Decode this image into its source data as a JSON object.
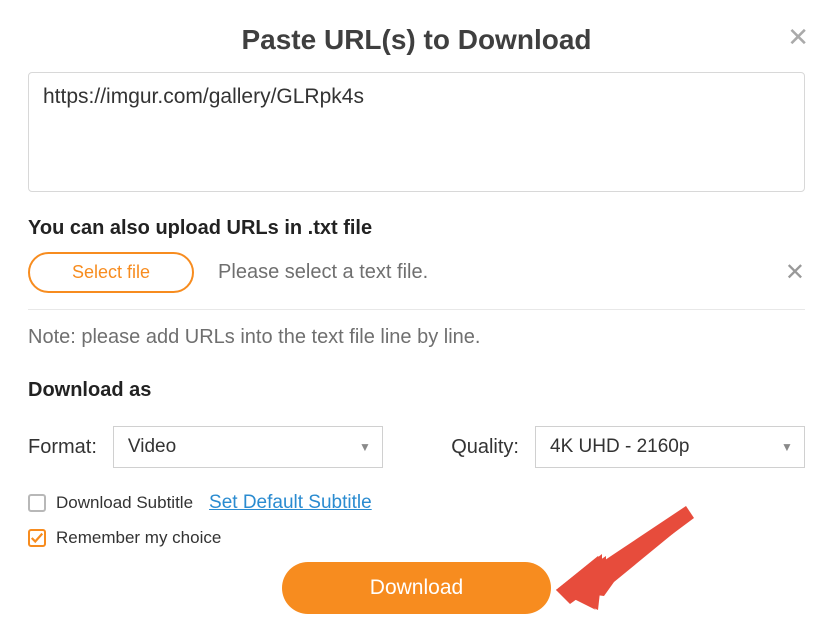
{
  "header": {
    "title": "Paste URL(s) to Download"
  },
  "url_input": {
    "value": "https://imgur.com/gallery/GLRpk4s"
  },
  "upload": {
    "heading": "You can also upload URLs in .txt file",
    "select_file_label": "Select file",
    "hint": "Please select a text file.",
    "note": "Note: please add URLs into the text file line by line."
  },
  "download_as": {
    "heading": "Download as",
    "format_label": "Format:",
    "format_value": "Video",
    "quality_label": "Quality:",
    "quality_value": "4K UHD - 2160p"
  },
  "subtitle": {
    "checkbox_label": "Download Subtitle",
    "link_label": "Set Default Subtitle"
  },
  "remember": {
    "checkbox_label": "Remember my choice"
  },
  "download_button": "Download"
}
